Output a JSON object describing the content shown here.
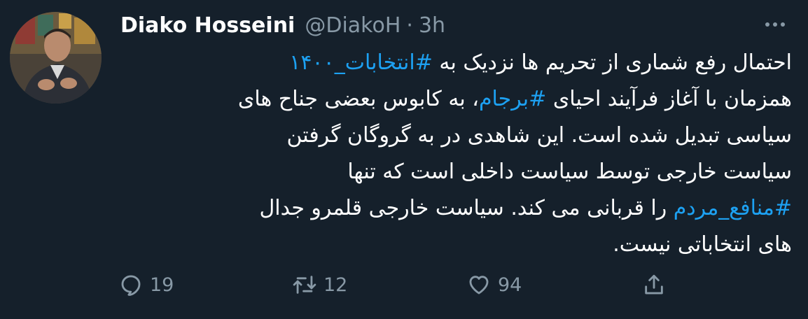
{
  "tweet": {
    "author_name": "Diako Hosseini",
    "handle": "@DiakoH",
    "separator": "·",
    "time": "3h",
    "more_icon": "more-dots-icon",
    "avatar_icon": "profile-photo",
    "lines": [
      [
        {
          "text": "احتمال رفع شماری از تحریم ها نزدیک به ",
          "type": "text"
        },
        {
          "text": "#انتخابات_۱۴۰۰",
          "type": "hashtag"
        }
      ],
      [
        {
          "text": "همزمان با آغاز فرآیند احیای ",
          "type": "text"
        },
        {
          "text": "#برجام",
          "type": "hashtag"
        },
        {
          "text": "، به کابوس بعضی جناح های",
          "type": "text"
        }
      ],
      [
        {
          "text": "سیاسی تبدیل شده است. این شاهدی در به گروگان گرفتن",
          "type": "text"
        }
      ],
      [
        {
          "text": "سیاست خارجی توسط سیاست داخلی است که تنها",
          "type": "text"
        }
      ],
      [
        {
          "text": "#منافع_مردم",
          "type": "hashtag"
        },
        {
          "text": " را قربانی می کند. سیاست خارجی قلمرو جدال",
          "type": "text"
        }
      ],
      [
        {
          "text": "های انتخاباتی نیست.",
          "type": "text"
        }
      ]
    ],
    "actions": {
      "reply": {
        "icon": "reply-icon",
        "count": "19"
      },
      "retweet": {
        "icon": "retweet-icon",
        "count": "12"
      },
      "like": {
        "icon": "heart-icon",
        "count": "94"
      },
      "share": {
        "icon": "share-icon"
      }
    }
  }
}
